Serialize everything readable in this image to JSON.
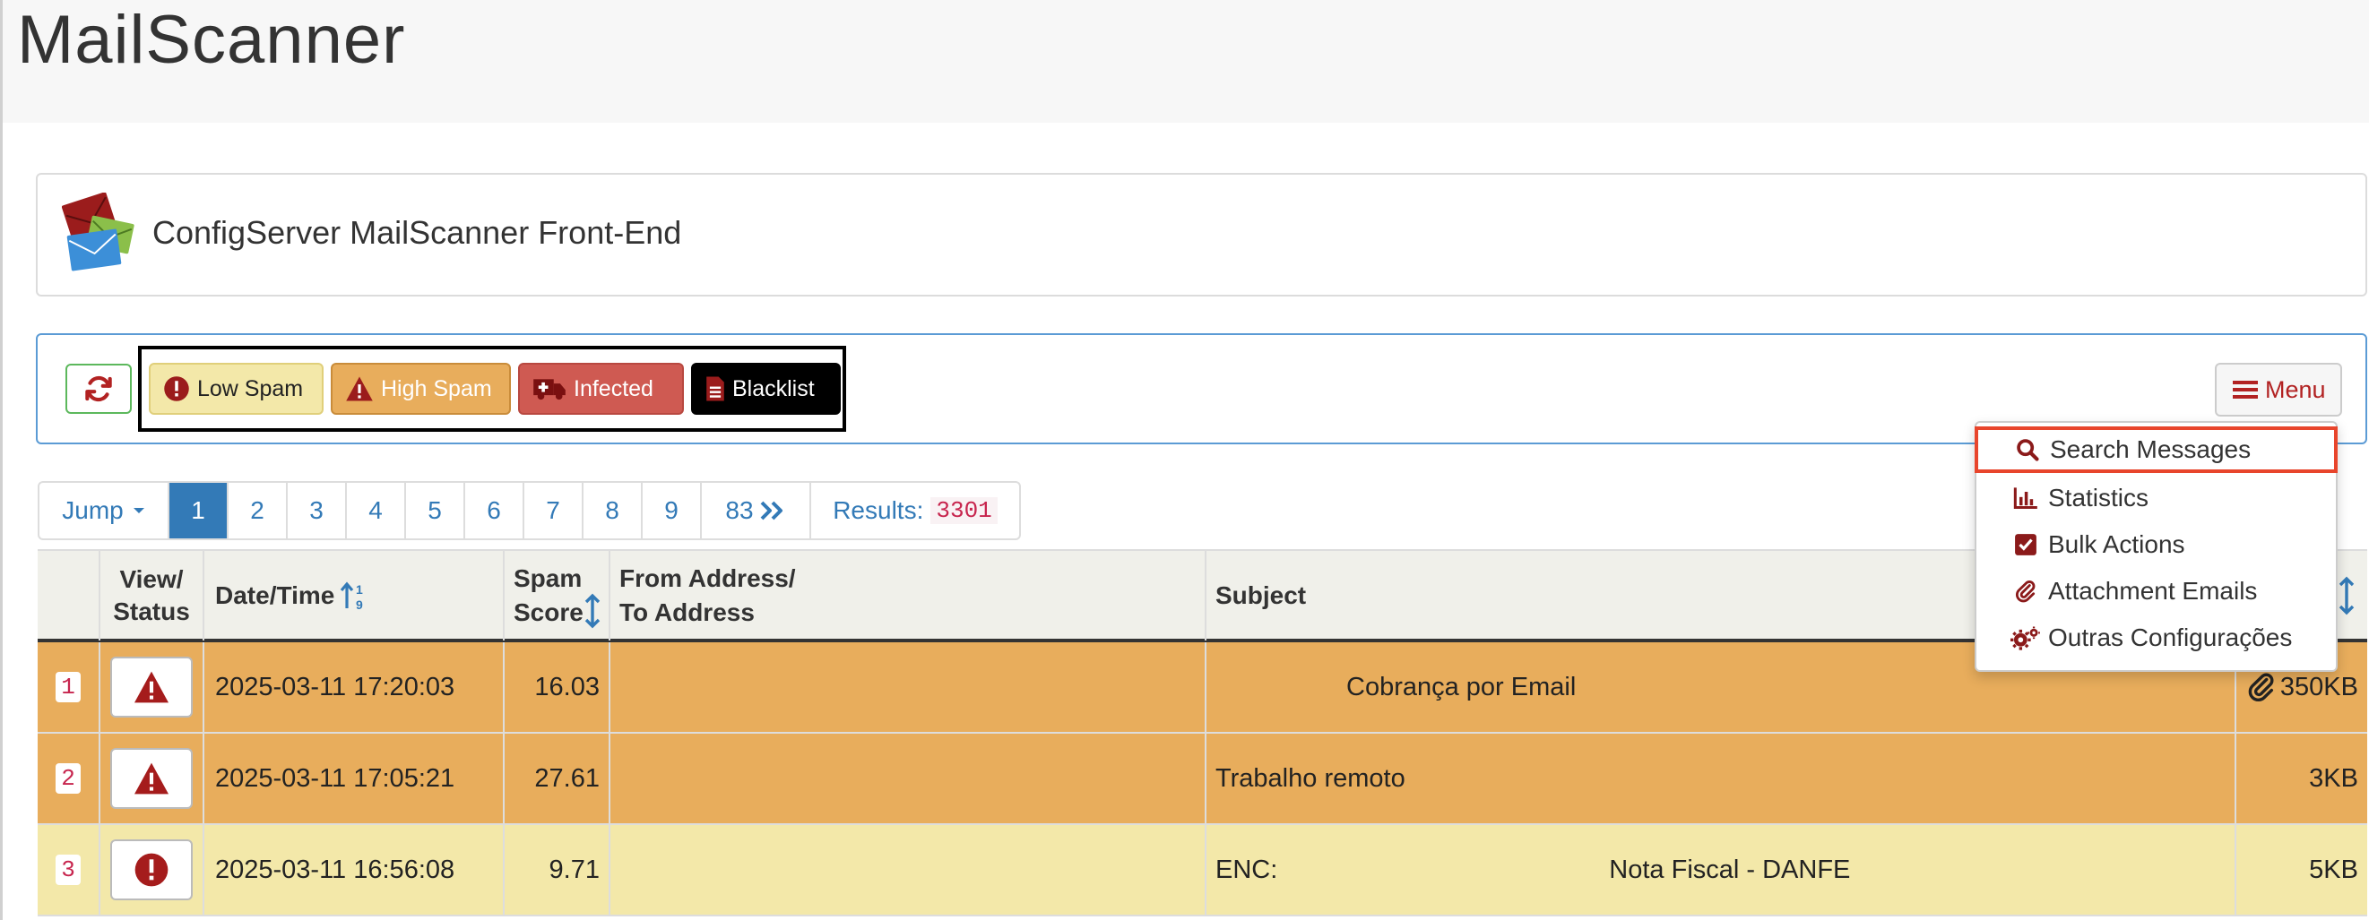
{
  "app": {
    "title": "MailScanner"
  },
  "brand": {
    "title": "ConfigServer MailScanner Front-End"
  },
  "toolbar": {
    "legend": {
      "low_spam": "Low Spam",
      "high_spam": "High Spam",
      "infected": "Infected",
      "blacklist": "Blacklist"
    },
    "menu_label": "Menu"
  },
  "pager": {
    "jump_label": "Jump",
    "pages": [
      "1",
      "2",
      "3",
      "4",
      "5",
      "6",
      "7",
      "8",
      "9"
    ],
    "last_page": "83",
    "results_label": "Results:",
    "results_count": "3301"
  },
  "table": {
    "headers": {
      "view_status": [
        "View/",
        "Status"
      ],
      "datetime": "Date/Time",
      "spam_score": [
        "Spam",
        "Score"
      ],
      "from_to": [
        "From Address/",
        "To Address"
      ],
      "subject": "Subject"
    },
    "rows": [
      {
        "num": "1",
        "status": "high-spam",
        "datetime": "2025-03-11 17:20:03",
        "score": "16.03",
        "from_to": "",
        "subject": "Cobrança por Email",
        "attachment": true,
        "size": "350KB"
      },
      {
        "num": "2",
        "status": "high-spam",
        "datetime": "2025-03-11 17:05:21",
        "score": "27.61",
        "from_to": "",
        "subject": "Trabalho remoto",
        "attachment": false,
        "size": "3KB"
      },
      {
        "num": "3",
        "status": "low-spam",
        "datetime": "2025-03-11 16:56:08",
        "score": "9.71",
        "from_to": "",
        "subject_prefix": "ENC: ",
        "subject": "Nota Fiscal - DANFE",
        "attachment": false,
        "size": "5KB"
      }
    ]
  },
  "menu": {
    "items": [
      {
        "label": "Search Messages",
        "icon": "search-icon"
      },
      {
        "label": "Statistics",
        "icon": "bar-chart-icon"
      },
      {
        "label": "Bulk Actions",
        "icon": "checkbox-icon"
      },
      {
        "label": "Attachment Emails",
        "icon": "paperclip-icon"
      },
      {
        "label": "Outras Configurações",
        "icon": "gears-icon"
      }
    ]
  },
  "colors": {
    "high_spam": "#e8ad5c",
    "low_spam": "#f3e8a9",
    "infected": "#cf5a52",
    "blacklist": "#000000",
    "link": "#337ab7",
    "danger_icon": "#a51c1c"
  }
}
